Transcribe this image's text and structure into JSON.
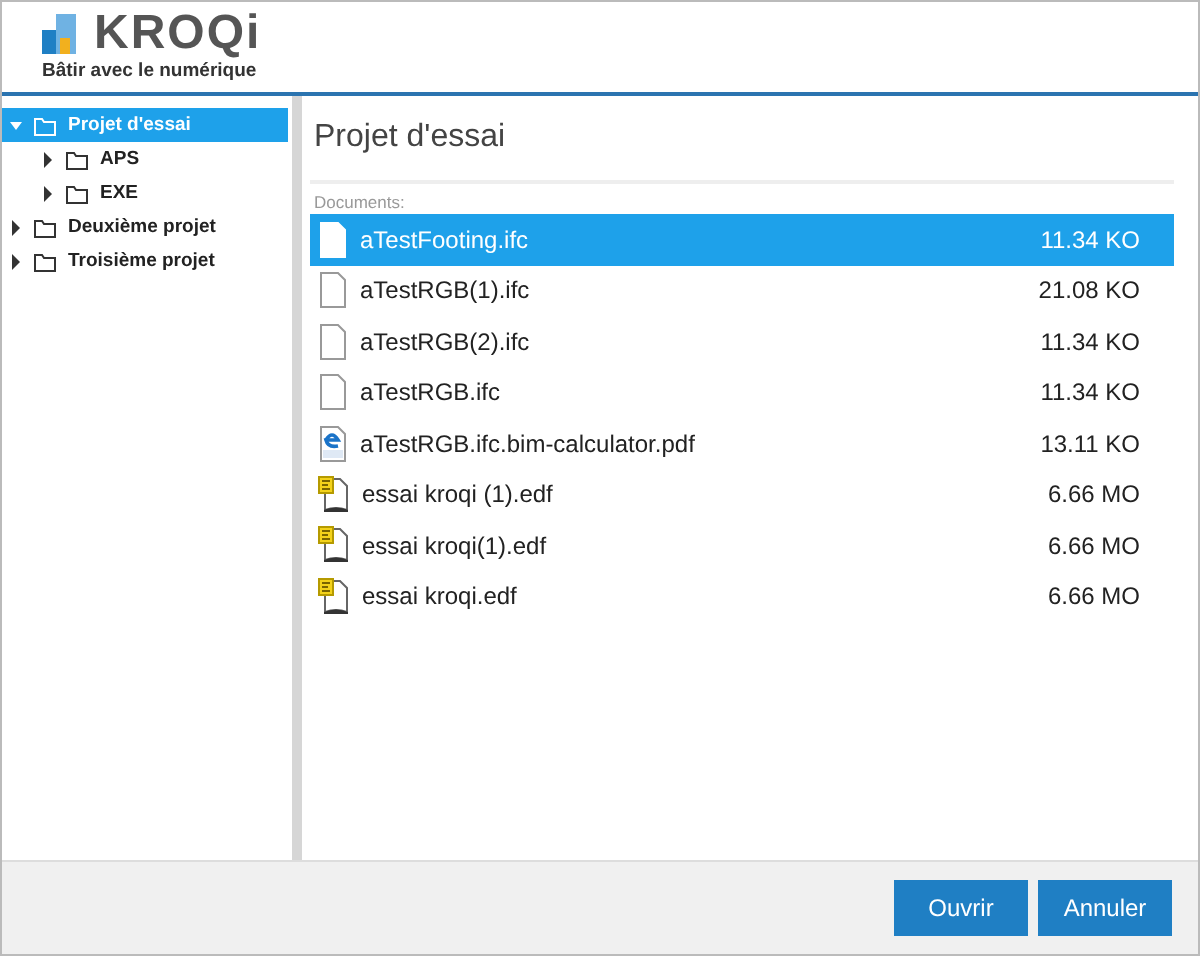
{
  "header": {
    "logo": "KROQi",
    "tagline": "Bâtir avec le numérique"
  },
  "tree": [
    {
      "label": "Projet d'essai",
      "selected": true,
      "expanded": true,
      "children": [
        {
          "label": "APS",
          "selected": false,
          "expanded": false
        },
        {
          "label": "EXE",
          "selected": false,
          "expanded": false
        }
      ]
    },
    {
      "label": "Deuxième projet",
      "selected": false,
      "expanded": false
    },
    {
      "label": "Troisième projet",
      "selected": false,
      "expanded": false
    }
  ],
  "content": {
    "title": "Projet d'essai",
    "section_label": "Documents:",
    "files": [
      {
        "name": "aTestFooting.ifc",
        "size": "11.34 KO",
        "kind": "blank",
        "selected": true
      },
      {
        "name": "aTestRGB(1).ifc",
        "size": "21.08 KO",
        "kind": "blank",
        "selected": false
      },
      {
        "name": "aTestRGB(2).ifc",
        "size": "11.34 KO",
        "kind": "blank",
        "selected": false
      },
      {
        "name": "aTestRGB.ifc",
        "size": "11.34 KO",
        "kind": "blank",
        "selected": false
      },
      {
        "name": "aTestRGB.ifc.bim-calculator.pdf",
        "size": "13.11 KO",
        "kind": "pdf",
        "selected": false
      },
      {
        "name": "essai kroqi (1).edf",
        "size": "6.66 MO",
        "kind": "edf",
        "selected": false
      },
      {
        "name": "essai kroqi(1).edf",
        "size": "6.66 MO",
        "kind": "edf",
        "selected": false
      },
      {
        "name": "essai kroqi.edf",
        "size": "6.66 MO",
        "kind": "edf",
        "selected": false
      }
    ]
  },
  "buttons": [
    "Ouvrir",
    "Annuler"
  ]
}
